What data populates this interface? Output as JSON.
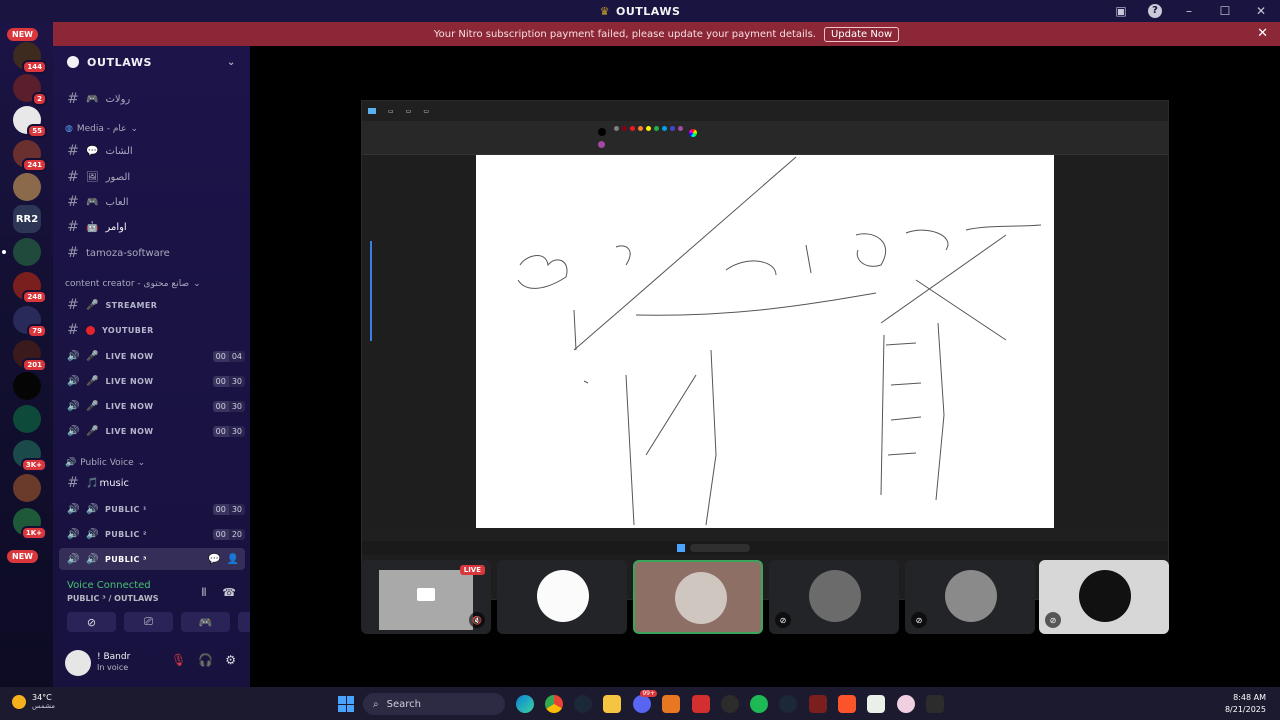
{
  "window": {
    "title": "OUTLAWS"
  },
  "banner": {
    "message": "Your Nitro subscription payment failed, please update your payment details.",
    "button": "Update Now"
  },
  "guilds": {
    "new_top": "NEW",
    "new_bottom": "NEW",
    "badges": [
      "144",
      "2",
      "55",
      "241",
      "248",
      "79",
      "201",
      "3K+",
      "1K+"
    ],
    "rr2": "RR2"
  },
  "server": {
    "name": "OUTLAWS"
  },
  "channels": {
    "c1": "رولات",
    "media_cat": "Media - عام",
    "c2": "الشات",
    "c3": "الصور",
    "c4": "العاب",
    "c5": "اوامر",
    "c6": "tamoza-software",
    "creator_cat": "content creator - صانع محتوى",
    "c7": "STREAMER",
    "c8": "YOUTUBER",
    "live": "LIVE NOW",
    "live_counts": [
      [
        "00",
        "04"
      ],
      [
        "00",
        "30"
      ],
      [
        "00",
        "30"
      ],
      [
        "00",
        "30"
      ]
    ],
    "public_cat": "Public Voice",
    "music": "music",
    "p1": "PUBLIC ¹",
    "p1_count": [
      "00",
      "30"
    ],
    "p2": "PUBLIC ²",
    "p2_count": [
      "00",
      "20"
    ],
    "p3": "PUBLIC ³"
  },
  "voice": {
    "status": "Voice Connected",
    "location": "PUBLIC ³ / OUTLAWS"
  },
  "user": {
    "name": "! Bandr",
    "status": "In voice"
  },
  "stream": {
    "live_badge": "LIVE"
  },
  "taskbar": {
    "temp": "34°C",
    "weather": "مشمس",
    "search": "Search",
    "time": "8:48 AM",
    "date": "8/21/2025",
    "notif": "99+"
  },
  "colors": {
    "accent_green": "#45c46e",
    "danger": "#da373c",
    "banner": "#8c2737"
  }
}
